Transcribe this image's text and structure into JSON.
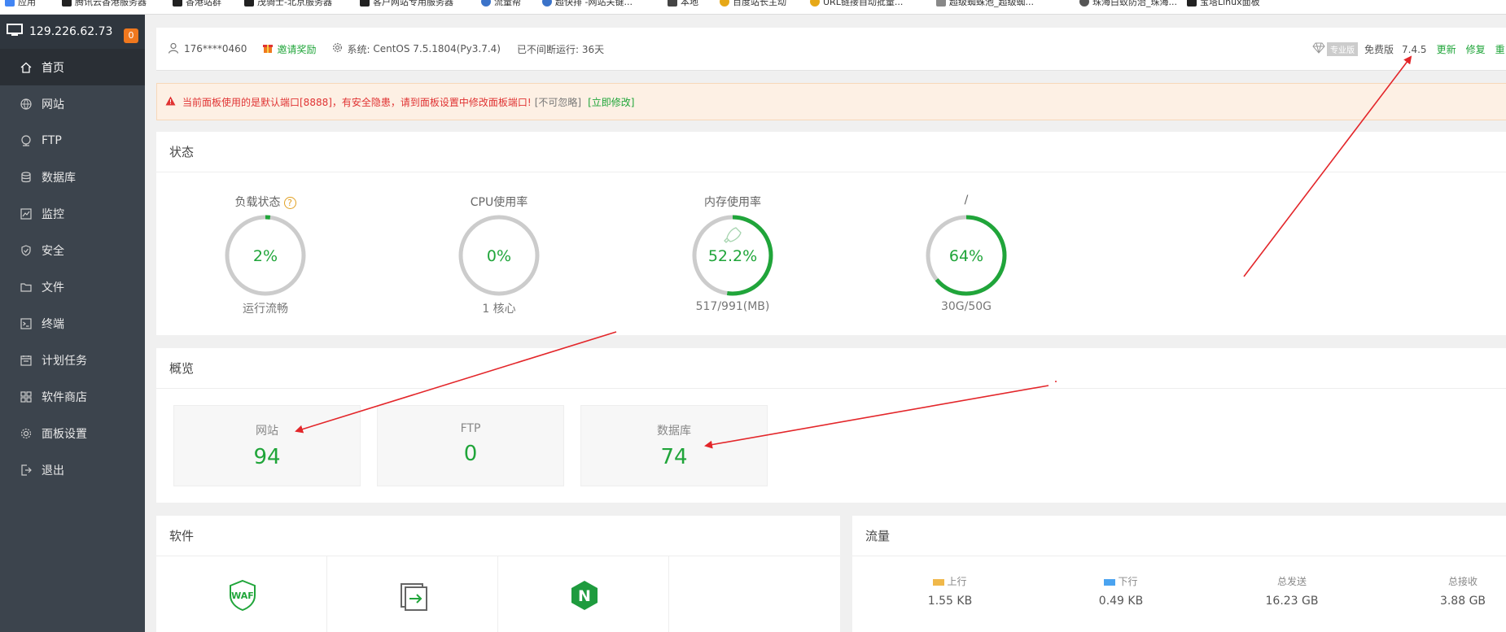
{
  "bookmarks": [
    {
      "label": "应用",
      "color": "#4285f4"
    },
    {
      "label": "腾讯云香港服务器",
      "color": "#222"
    },
    {
      "label": "香港站群",
      "color": "#222"
    },
    {
      "label": "茂骑士-北京服务器",
      "color": "#222"
    },
    {
      "label": "客户网站专用服务器",
      "color": "#222"
    },
    {
      "label": "流量帮",
      "color": "#3b73c9"
    },
    {
      "label": "超快排 -网站关键...",
      "color": "#3b73c9"
    },
    {
      "label": "本地",
      "color": "#444"
    },
    {
      "label": "百度站长主动",
      "color": "#e6a817"
    },
    {
      "label": "URL链接自动批量...",
      "color": "#e6a817"
    },
    {
      "label": "超级蜘蛛池_超级蜘...",
      "color": "#888"
    },
    {
      "label": "珠海白蚁防治_珠海...",
      "color": "#555"
    },
    {
      "label": "宝塔Linux面板",
      "color": "#222"
    }
  ],
  "sidebar": {
    "server_ip": "129.226.62.73",
    "badge": "0",
    "items": [
      {
        "label": "首页",
        "icon": "home-icon",
        "active": true
      },
      {
        "label": "网站",
        "icon": "globe-icon",
        "active": false
      },
      {
        "label": "FTP",
        "icon": "ftp-icon",
        "active": false
      },
      {
        "label": "数据库",
        "icon": "database-icon",
        "active": false
      },
      {
        "label": "监控",
        "icon": "monitor-icon",
        "active": false
      },
      {
        "label": "安全",
        "icon": "shield-icon",
        "active": false
      },
      {
        "label": "文件",
        "icon": "folder-icon",
        "active": false
      },
      {
        "label": "终端",
        "icon": "terminal-icon",
        "active": false
      },
      {
        "label": "计划任务",
        "icon": "calendar-icon",
        "active": false
      },
      {
        "label": "软件商店",
        "icon": "apps-icon",
        "active": false
      },
      {
        "label": "面板设置",
        "icon": "gear-icon",
        "active": false
      },
      {
        "label": "退出",
        "icon": "logout-icon",
        "active": false
      }
    ]
  },
  "topbar": {
    "user": "176****0460",
    "invite": "邀请奖励",
    "system_label": "系统:",
    "system_value": "CentOS 7.5.1804(Py3.7.4)",
    "uptime": "已不间断运行: 36天",
    "pro_label": "专业版",
    "free_label": "免费版",
    "version": "7.4.5",
    "update": "更新",
    "repair": "修复",
    "restart": "重"
  },
  "alert": {
    "text": "当前面板使用的是默认端口[8888]，有安全隐患，请到面板设置中修改面板端口!",
    "ignore": "[不可忽略]",
    "fix": "[立即修改]"
  },
  "status": {
    "title": "状态",
    "gauges": [
      {
        "label": "负载状态",
        "value": "2%",
        "percent": 2,
        "sub": "运行流畅",
        "help": "?"
      },
      {
        "label": "CPU使用率",
        "value": "0%",
        "percent": 0,
        "sub": "1 核心"
      },
      {
        "label": "内存使用率",
        "value": "52.2%",
        "percent": 52.2,
        "sub": "517/991(MB)"
      },
      {
        "label": "/",
        "value": "64%",
        "percent": 64,
        "sub": "30G/50G"
      }
    ]
  },
  "overview": {
    "title": "概览",
    "items": [
      {
        "label": "网站",
        "value": "94"
      },
      {
        "label": "FTP",
        "value": "0"
      },
      {
        "label": "数据库",
        "value": "74"
      }
    ]
  },
  "software": {
    "title": "软件",
    "items": [
      {
        "icon": "waf-icon",
        "icon_text": "WAF"
      },
      {
        "icon": "file-transfer-icon"
      },
      {
        "icon": "nginx-icon",
        "icon_text": "N"
      },
      {
        "icon": ""
      }
    ]
  },
  "traffic": {
    "title": "流量",
    "items": [
      {
        "label": "上行",
        "value": "1.55 KB",
        "color": "#f0b84a"
      },
      {
        "label": "下行",
        "value": "0.49 KB",
        "color": "#4aa3f0"
      },
      {
        "label": "总发送",
        "value": "16.23 GB"
      },
      {
        "label": "总接收",
        "value": "3.88 GB"
      }
    ]
  },
  "colors": {
    "accent": "#20a53a",
    "sidebar": "#3c444d",
    "alert": "#e03333",
    "arrow": "#e3262a"
  }
}
